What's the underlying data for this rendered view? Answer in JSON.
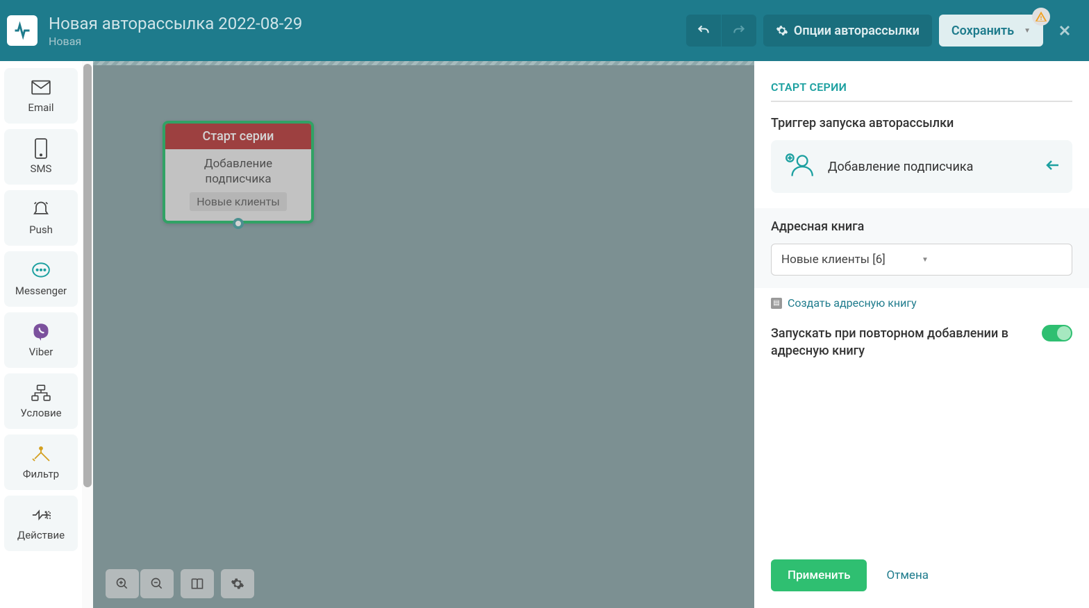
{
  "header": {
    "title": "Новая авторассылка 2022-08-29",
    "subtitle": "Новая",
    "options_label": "Опции авторассылки",
    "save_label": "Сохранить"
  },
  "sidebar": {
    "items": [
      {
        "label": "Email"
      },
      {
        "label": "SMS"
      },
      {
        "label": "Push"
      },
      {
        "label": "Messenger"
      },
      {
        "label": "Viber"
      },
      {
        "label": "Условие"
      },
      {
        "label": "Фильтр"
      },
      {
        "label": "Действие"
      }
    ]
  },
  "canvas": {
    "node": {
      "title": "Старт серии",
      "line1": "Добавление",
      "line2": "подписчика",
      "tag": "Новые клиенты"
    }
  },
  "panel": {
    "title": "СТАРТ СЕРИИ",
    "trigger_label": "Триггер запуска авторассылки",
    "trigger_value": "Добавление подписчика",
    "addrbook_label": "Адресная книга",
    "addrbook_value": "Новые клиенты [6]",
    "create_link": "Создать адресную книгу",
    "toggle_label": "Запускать при повторном добавлении в адресную книгу",
    "apply_label": "Применить",
    "cancel_label": "Отмена"
  }
}
